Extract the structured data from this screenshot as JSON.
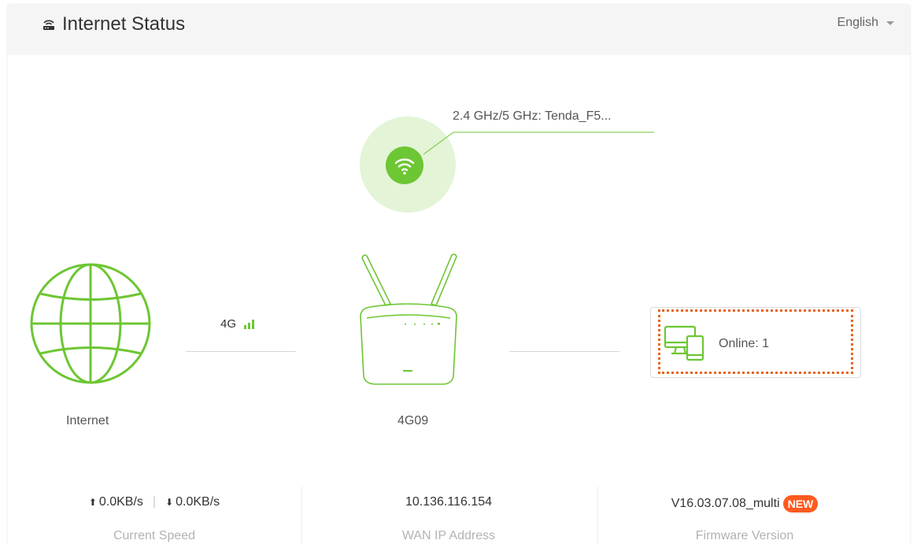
{
  "header": {
    "title": "Internet Status",
    "title_icon": "router-icon",
    "language": "English"
  },
  "wifi": {
    "ssid_label": "2.4 GHz/5 GHz: Tenda_F5...",
    "icon": "wifi-icon",
    "accent_color": "#6dc633"
  },
  "internet": {
    "label": "Internet",
    "icon": "globe-icon"
  },
  "connection": {
    "type": "4G",
    "signal_icon": "signal-bars-icon"
  },
  "router": {
    "model": "4G09",
    "icon": "router-device-icon"
  },
  "clients": {
    "online_text": "Online:  1",
    "icon": "devices-icon",
    "highlight_color": "#e8641b"
  },
  "stats": {
    "upload": "0.0KB/s",
    "download": "0.0KB/s",
    "speed_label": "Current Speed",
    "wan_ip": "10.136.116.154",
    "wan_ip_label": "WAN IP Address",
    "firmware": "V16.03.07.08_multi",
    "firmware_badge": "NEW",
    "firmware_label": "Firmware Version"
  }
}
